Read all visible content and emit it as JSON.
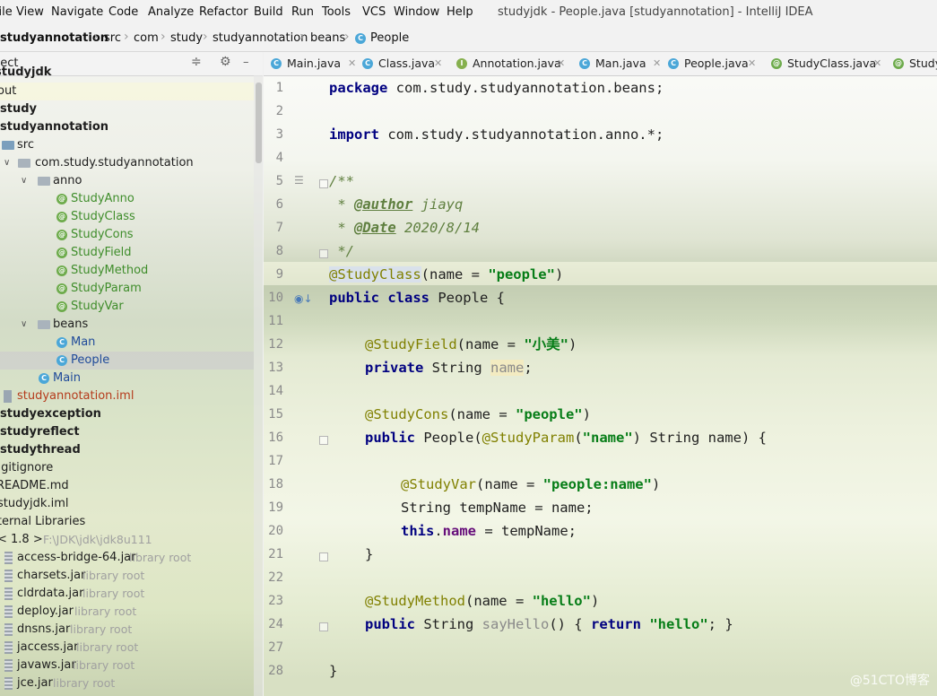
{
  "menu": [
    "File",
    "View",
    "Navigate",
    "Code",
    "Analyze",
    "Refactor",
    "Build",
    "Run",
    "Tools",
    "VCS",
    "Window",
    "Help"
  ],
  "window_title": "studyjdk - People.java [studyannotation] - IntelliJ IDEA",
  "breadcrumbs": [
    "studyannotation",
    "src",
    "com",
    "study",
    "studyannotation",
    "beans",
    "People"
  ],
  "project_panel": {
    "title": "Project",
    "rows": [
      {
        "label": "studyjdk",
        "hint": ""
      },
      {
        "label": "out",
        "hint": ""
      },
      {
        "label": "study",
        "hint": ""
      },
      {
        "label": "studyannotation",
        "hint": ""
      },
      {
        "label": "src",
        "hint": ""
      },
      {
        "label": "com.study.studyannotation",
        "hint": ""
      },
      {
        "label": "anno",
        "hint": ""
      },
      {
        "label": "StudyAnno",
        "hint": ""
      },
      {
        "label": "StudyClass",
        "hint": ""
      },
      {
        "label": "StudyCons",
        "hint": ""
      },
      {
        "label": "StudyField",
        "hint": ""
      },
      {
        "label": "StudyMethod",
        "hint": ""
      },
      {
        "label": "StudyParam",
        "hint": ""
      },
      {
        "label": "StudyVar",
        "hint": ""
      },
      {
        "label": "beans",
        "hint": ""
      },
      {
        "label": "Man",
        "hint": ""
      },
      {
        "label": "People",
        "hint": ""
      },
      {
        "label": "Main",
        "hint": ""
      },
      {
        "label": "studyannotation.iml",
        "hint": ""
      },
      {
        "label": "studyexception",
        "hint": ""
      },
      {
        "label": "studyreflect",
        "hint": ""
      },
      {
        "label": "studythread",
        "hint": ""
      },
      {
        "label": ".gitignore",
        "hint": ""
      },
      {
        "label": "README.md",
        "hint": ""
      },
      {
        "label": "studyjdk.iml",
        "hint": ""
      },
      {
        "label": "External Libraries",
        "hint": ""
      },
      {
        "label": "< 1.8 >",
        "hint": "F:\\JDK\\jdk\\jdk8u111"
      },
      {
        "label": "access-bridge-64.jar",
        "hint": "library root"
      },
      {
        "label": "charsets.jar",
        "hint": "library root"
      },
      {
        "label": "cldrdata.jar",
        "hint": "library root"
      },
      {
        "label": "deploy.jar",
        "hint": "library root"
      },
      {
        "label": "dnsns.jar",
        "hint": "library root"
      },
      {
        "label": "jaccess.jar",
        "hint": "library root"
      },
      {
        "label": "javaws.jar",
        "hint": "library root"
      },
      {
        "label": "jce.jar",
        "hint": "library root"
      }
    ]
  },
  "tabs": [
    "Main.java",
    "Class.java",
    "Annotation.java",
    "Man.java",
    "People.java",
    "StudyClass.java",
    "Study"
  ],
  "line_numbers": [
    "1",
    "2",
    "3",
    "4",
    "5",
    "6",
    "7",
    "8",
    "9",
    "10",
    "11",
    "12",
    "13",
    "14",
    "15",
    "16",
    "17",
    "18",
    "19",
    "20",
    "21",
    "22",
    "23",
    "24",
    "27",
    "28"
  ],
  "code": {
    "pkg_kw": "package",
    "pkg_name": " com.study.studyannotation.beans;",
    "imp_kw": "import",
    "imp_name": " com.study.studyannotation.anno.*;",
    "doc_open": "/**",
    "doc_author_star": " * ",
    "doc_author_tag": "@author",
    "doc_author_val": " jiayq",
    "doc_date_star": " * ",
    "doc_date_tag": "@Date",
    "doc_date_val": " 2020/8/14",
    "doc_close": " */",
    "cls_ann": "@StudyClass",
    "cls_ann_args_a": "(name = ",
    "cls_ann_str": "\"people\"",
    "cls_ann_args_b": ")",
    "cls_kw": "public class",
    "cls_name": " People {",
    "fld_ann": "@StudyField",
    "fld_args_a": "(name = ",
    "fld_str": "\"小美\"",
    "fld_args_b": ")",
    "fld_kw": "private",
    "fld_type": " String ",
    "fld_name": "name",
    "fld_end": ";",
    "cons_ann": "@StudyCons",
    "cons_args_a": "(name = ",
    "cons_str": "\"people\"",
    "cons_args_b": ")",
    "cons_kw": "public",
    "cons_sig_a": " People(",
    "cons_param_ann": "@StudyParam",
    "cons_sig_b": "(",
    "cons_param_str": "\"name\"",
    "cons_sig_c": ") String name) {",
    "var_ann": "@StudyVar",
    "var_args_a": "(name = ",
    "var_str": "\"people:name\"",
    "var_args_b": ")",
    "var_decl": "String tempName = name;",
    "this_kw": "this",
    "this_dot": ".",
    "this_field": "name",
    "this_rest": " = tempName;",
    "close_brace_inner": "}",
    "meth_ann": "@StudyMethod",
    "meth_args_a": "(name = ",
    "meth_str": "\"hello\"",
    "meth_args_b": ")",
    "meth_kw": "public",
    "meth_type": " String ",
    "meth_name": "sayHello",
    "meth_sig": "() { ",
    "meth_ret_kw": "return",
    "meth_sp": " ",
    "meth_ret_str": "\"hello\"",
    "meth_end": "; }",
    "close_brace_outer": "}"
  },
  "watermark": "@51CTO博客"
}
